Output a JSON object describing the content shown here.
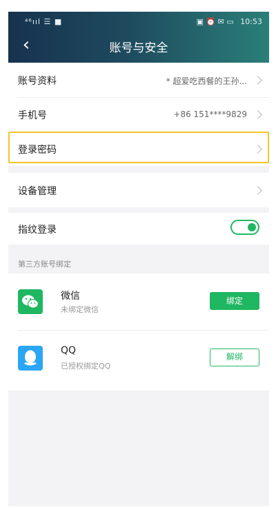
{
  "status_bar": {
    "signal": "⁴⁶ııl ☰ ■",
    "icons": "▣ ⏰ ✉ ▭",
    "time": "10:53"
  },
  "header": {
    "title": "账号与安全"
  },
  "rows": {
    "profile": {
      "label": "账号资料",
      "value": "* 超爱吃西餐的王孙..."
    },
    "phone": {
      "label": "手机号",
      "value": "+86 151****9829"
    },
    "password": {
      "label": "登录密码"
    },
    "devices": {
      "label": "设备管理"
    },
    "fingerprint": {
      "label": "指纹登录",
      "enabled": true
    }
  },
  "third_party": {
    "heading": "第三方账号绑定",
    "accounts": [
      {
        "name": "微信",
        "status": "未绑定微信",
        "action": "绑定",
        "icon": "wechat-icon",
        "color": "#1fb761"
      },
      {
        "name": "QQ",
        "status": "已授权绑定QQ",
        "action": "解绑",
        "icon": "qq-icon",
        "color": "#2ba6f5"
      }
    ]
  },
  "colors": {
    "accent": "#1fb761",
    "highlight": "#f6c526",
    "header_start": "#17324f",
    "header_end": "#2a7f78"
  }
}
